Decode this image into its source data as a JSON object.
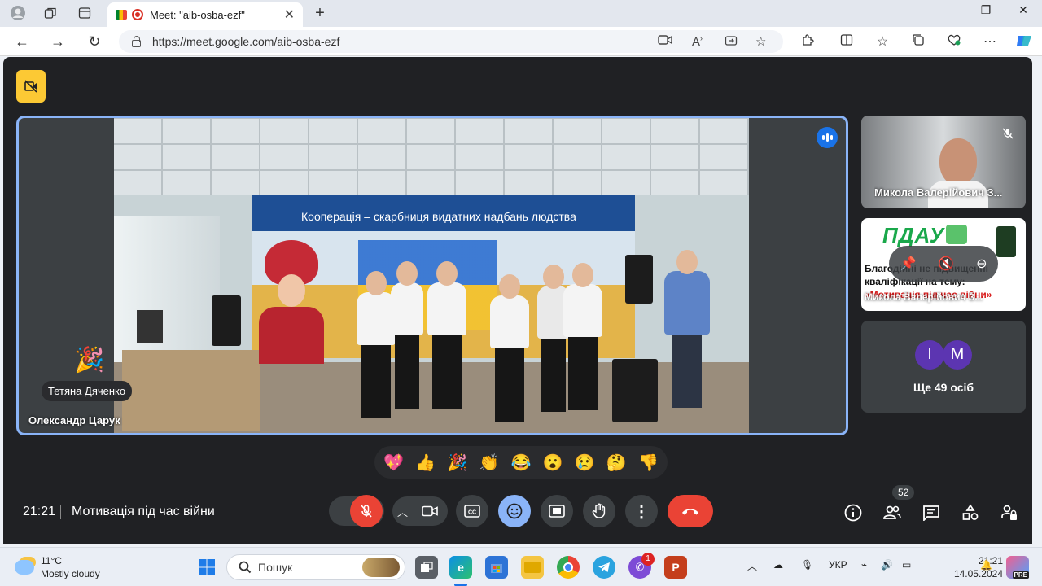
{
  "browser": {
    "tab_title": "Meet: \"aib-osba-ezf\"",
    "url": "https://meet.google.com/aib-osba-ezf"
  },
  "meet": {
    "main_participant": "Олександр Царук",
    "reaction": {
      "emoji": "🎉",
      "name": "Тетяна Дяченко"
    },
    "banner_text": "Кооперація – скарбниця видатних надбань людства",
    "side_tiles": [
      {
        "name": "Микола Валерійович З...",
        "muted": true
      },
      {
        "name": "Микола Валерійович З...",
        "logo_text": "ПДАУ",
        "line1": "Благодійні не підвищенні",
        "line2": "кваліфікації на тему:",
        "line3": "«Мотивація під час війни»"
      },
      {
        "avatars": [
          "І",
          "М"
        ],
        "avatar_colors": [
          "#5c35b1",
          "#5c35b1"
        ],
        "more_label": "Ще 49 осіб"
      }
    ],
    "reactions_bar": [
      "💖",
      "👍",
      "🎉",
      "👏",
      "😂",
      "😮",
      "😢",
      "🤔",
      "👎"
    ],
    "meeting_time": "21:21",
    "meeting_title": "Мотивація під час війни",
    "participants_count": "52",
    "colors": {
      "end_call": "#ea4335",
      "mic_muted": "#ea4335",
      "reactions_active": "#8ab4f8",
      "accent": "#1a73e8"
    }
  },
  "taskbar": {
    "weather_temp": "11°C",
    "weather_desc": "Mostly cloudy",
    "search_placeholder": "Пошук",
    "notification_count": "1",
    "language": "УКР",
    "time": "21:21",
    "date": "14.05.2024"
  }
}
